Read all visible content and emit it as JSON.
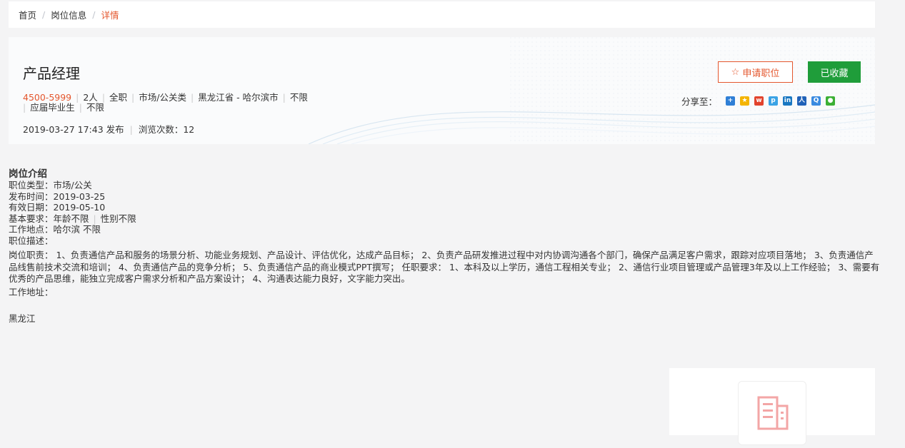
{
  "breadcrumb": {
    "home": "首页",
    "separator": "/",
    "section": "岗位信息",
    "current": "详情"
  },
  "job": {
    "title": "产品经理",
    "salary": "4500-5999",
    "headcount": "2人",
    "type": "全职",
    "category": "市场/公关类",
    "location": "黑龙江省 - 哈尔滨市",
    "experience": "不限",
    "education": "应届毕业生",
    "other": "不限",
    "published": "2019-03-27 17:43 发布",
    "views": "浏览次数：12"
  },
  "actions": {
    "apply_icon": "☆",
    "apply_label": "申请职位",
    "favorite_label": "已收藏"
  },
  "share": {
    "label": "分享至：",
    "icons": [
      "qzone-plus-icon",
      "star-icon",
      "weibo-icon",
      "pengyou-icon",
      "linkedin-icon",
      "renren-icon",
      "qq-icon",
      "wechat-icon"
    ]
  },
  "detail": {
    "section_title": "岗位介绍",
    "job_type": "职位类型：市场/公关",
    "publish_time": "发布时间：2019-03-25",
    "valid_date": "有效日期：2019-05-10",
    "basic_req_age": "基本要求：年龄不限",
    "basic_req_gender": "性别不限",
    "work_location": "工作地点：哈尔滨 不限",
    "desc_label": "职位描述：",
    "duties": "岗位职责： 1、负责通信产品和服务的场景分析、功能业务规划、产品设计、评估优化，达成产品目标； 2、负责产品研发推进过程中对内协调沟通各个部门，确保产品满足客户需求，跟踪对应项目落地； 3、负责通信产品线售前技术交流和培训； 4、负责通信产品的竞争分析； 5、负责通信产品的商业模式PPT撰写； 任职要求： 1、本科及以上学历，通信工程相关专业； 2、通信行业项目管理或产品管理3年及以上工作经验； 3、需要有优秀的产品思维，能独立完成客户需求分析和产品方案设计； 4、沟通表达能力良好，文字能力突出。",
    "address_label": "工作地址：",
    "address": "黑龙江"
  },
  "colors": {
    "accent": "#e4572e",
    "favorite_bg": "#1f9d3a",
    "building_icon": "#f3a6a6"
  }
}
